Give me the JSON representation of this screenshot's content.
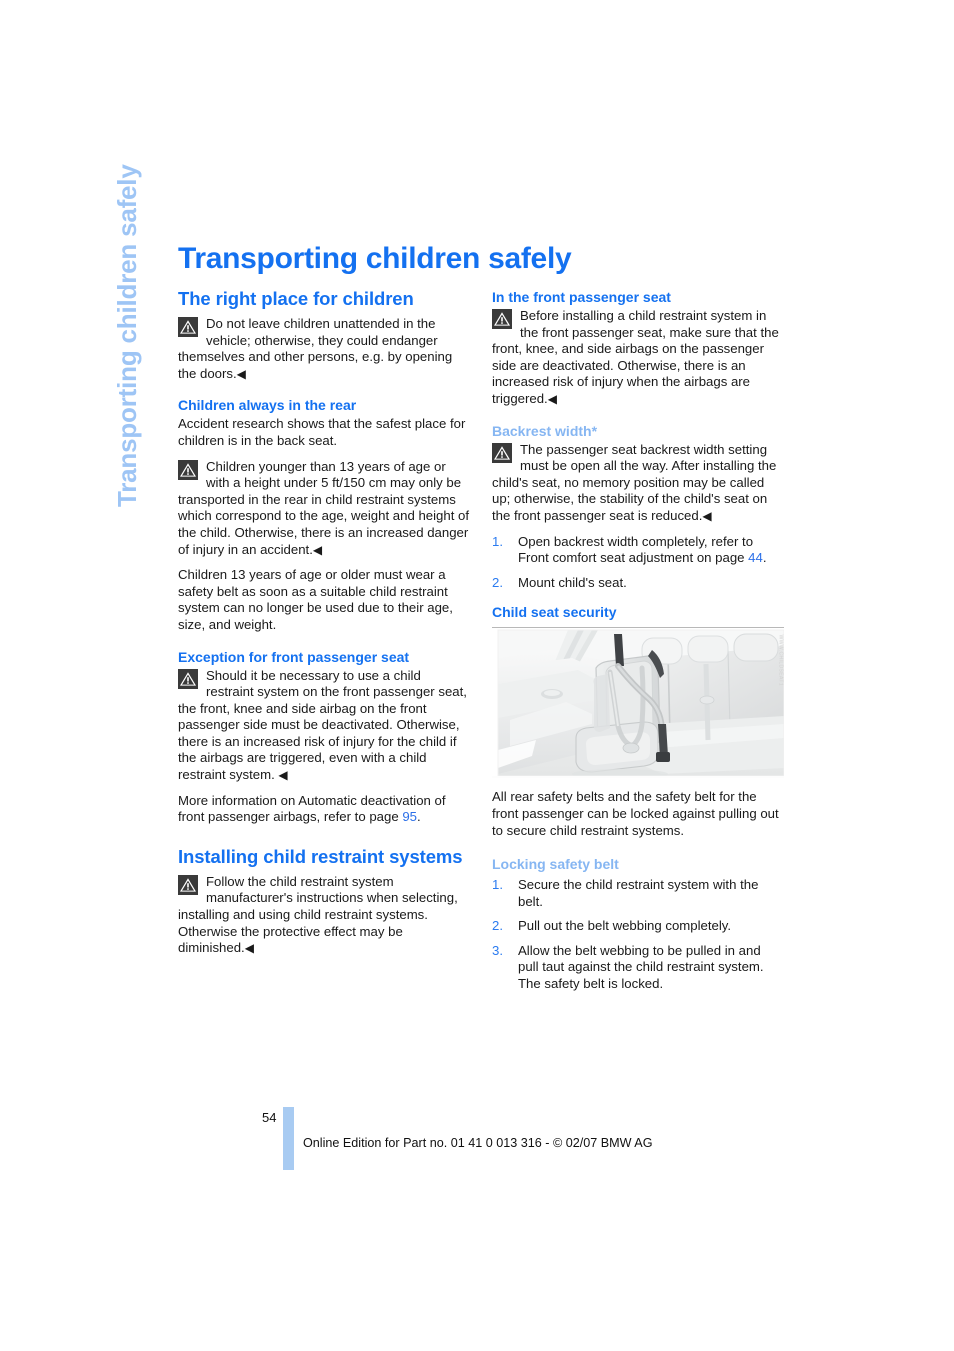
{
  "document": {
    "running_head": "Transporting children safely",
    "chapter_title": "Transporting children safely",
    "page_number": "54",
    "footer_text": "Online Edition for Part no. 01 41 0 013 316 - © 02/07 BMW AG",
    "accent_blue": "#1471f0",
    "pale_blue": "#86b6f2",
    "reference_blue": "#2b6fe8",
    "side_tab_blue": "#9ec5f5",
    "footer_bar_blue": "#a8cbf2",
    "end_of_message_mark": "◀"
  },
  "left_column": {
    "section_heading": "The right place for children",
    "warning_1": "Do not leave children unattended in the vehicle; otherwise, they could endanger themselves and other persons, e.g. by opening the doors.",
    "sub_1": {
      "heading": "Children always in the rear",
      "paragraph_1": "Accident research shows that the safest place for children is in the back seat.",
      "warning": "Children younger than 13 years of age or with a height under 5 ft/150 cm may only be transported in the rear in child restraint systems which correspond to the age, weight and height of the child. Otherwise, there is an increased danger of injury in an accident.",
      "paragraph_2": "Children 13 years of age or older must wear a safety belt as soon as a suitable child restraint system can no longer be used due to their age, size, and weight."
    },
    "sub_2": {
      "heading": "Exception for front passenger seat",
      "warning": "Should it be necessary to use a child restraint system on the front passenger seat, the front, knee and side airbag on the front passenger side must be deactivated. Otherwise, there is an increased risk of injury for the child if the airbags are triggered, even with a child restraint system.",
      "paragraph_prefix": "More information on Automatic deactivation of front passenger airbags, refer to page ",
      "paragraph_page_ref": "95",
      "paragraph_suffix": "."
    },
    "section_heading_2": "Installing child restraint systems",
    "warning_2": "Follow the child restraint system manufacturer's instructions when selecting, installing and using child restraint systems. Otherwise the protective effect may be diminished."
  },
  "right_column": {
    "sub_1": {
      "heading": "In the front passenger seat",
      "warning": "Before installing a child restraint system in the front passenger seat, make sure that the front, knee, and side airbags on the passenger side are deactivated. Otherwise, there is an increased risk of injury when the airbags are triggered."
    },
    "sub_2": {
      "heading": "Backrest width*",
      "warning": "The passenger seat backrest width setting must be open all the way. After installing the child's seat, no memory position may be called up; otherwise, the stability of the child's seat on the front passenger seat is reduced.",
      "steps": [
        {
          "number": "1.",
          "text_prefix": "Open backrest width completely, refer to Front comfort seat adjustment on page ",
          "page_ref": "44",
          "text_suffix": "."
        },
        {
          "number": "2.",
          "text_prefix": "Mount child's seat.",
          "page_ref": "",
          "text_suffix": ""
        }
      ]
    },
    "sub_3": {
      "heading": "Child seat security",
      "figure_alt": "Rear bench seat with child restraint system secured by the safety belt",
      "figure_code": "WWW.CHILDSEAT1",
      "paragraph": "All rear safety belts and the safety belt for the front passenger can be locked against pulling out to secure child restraint systems."
    },
    "sub_4": {
      "heading": "Locking safety belt",
      "steps": [
        {
          "number": "1.",
          "text": "Secure the child restraint system with the belt."
        },
        {
          "number": "2.",
          "text": "Pull out the belt webbing completely."
        },
        {
          "number": "3.",
          "text": "Allow the belt webbing to be pulled in and pull taut against the child restraint system. The safety belt is locked."
        }
      ]
    }
  },
  "icons": {
    "warning_triangle": "warning-triangle-icon"
  }
}
